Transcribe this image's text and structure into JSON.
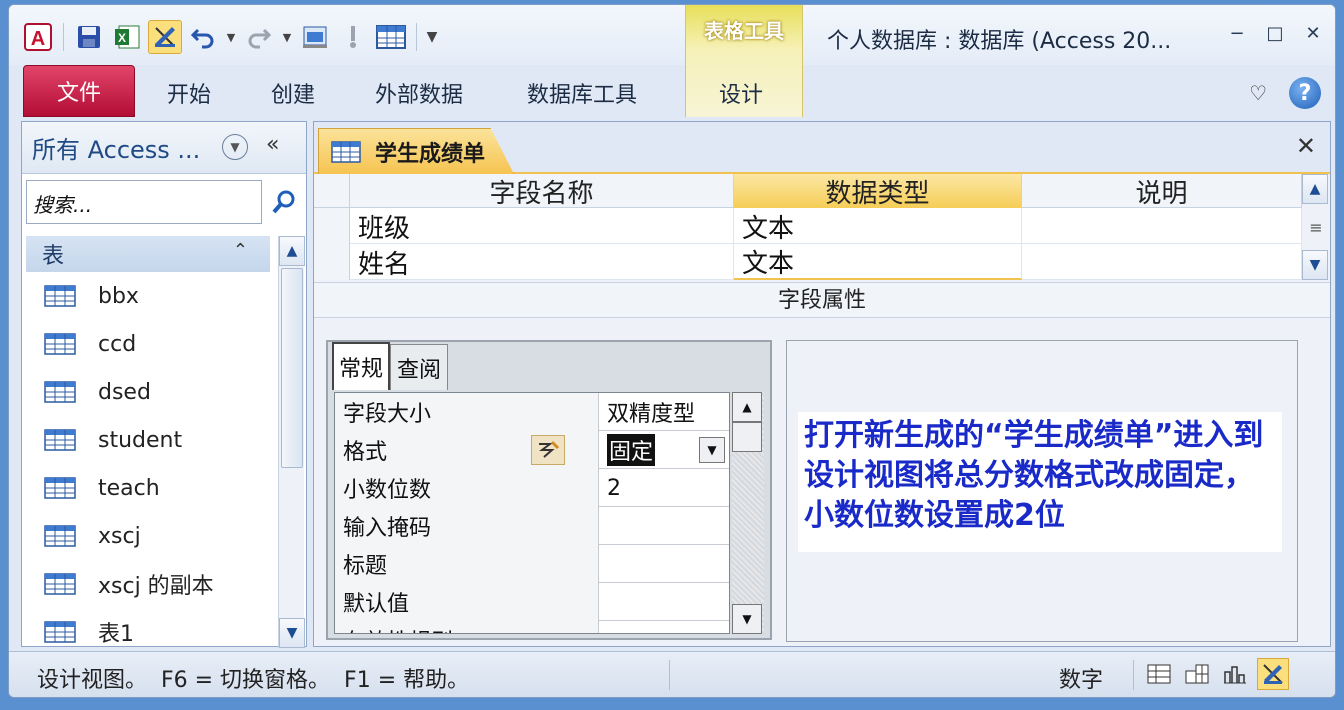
{
  "window": {
    "title": "个人数据库 : 数据库 (Access 20...",
    "context_group": "表格工具"
  },
  "ribbon": {
    "file_tab": "文件",
    "tabs": [
      "开始",
      "创建",
      "外部数据",
      "数据库工具",
      "设计"
    ]
  },
  "nav": {
    "title": "所有 Access ...",
    "search_placeholder": "搜索...",
    "group": "表",
    "items": [
      "bbx",
      "ccd",
      "dsed",
      "student",
      "teach",
      "xscj",
      "xscj 的副本",
      "表1"
    ]
  },
  "document": {
    "tab_title": "学生成绩单",
    "columns": [
      "字段名称",
      "数据类型",
      "说明"
    ],
    "rows": [
      {
        "name": "班级",
        "type": "文本",
        "desc": ""
      },
      {
        "name": "姓名",
        "type": "文本",
        "desc": ""
      }
    ],
    "field_props_label": "字段属性"
  },
  "properties": {
    "tabs": [
      "常规",
      "查阅"
    ],
    "rows": [
      {
        "label": "字段大小",
        "value": "双精度型"
      },
      {
        "label": "格式",
        "value": "固定"
      },
      {
        "label": "小数位数",
        "value": "2"
      },
      {
        "label": "输入掩码",
        "value": ""
      },
      {
        "label": "标题",
        "value": ""
      },
      {
        "label": "默认值",
        "value": ""
      },
      {
        "label": "有效性规则",
        "value": ""
      }
    ]
  },
  "annotation": "打开新生成的“学生成绩单”进入到设计视图将总分数格式改成固定，小数位数设置成2位",
  "status": {
    "text": "设计视图。  F6 = 切换窗格。  F1 = 帮助。",
    "mode": "数字"
  },
  "colors": {
    "accent": "#f6c451",
    "file_tab": "#c41a44",
    "annotation_text": "#1a2ac8",
    "frame": "#5a8fd0"
  }
}
